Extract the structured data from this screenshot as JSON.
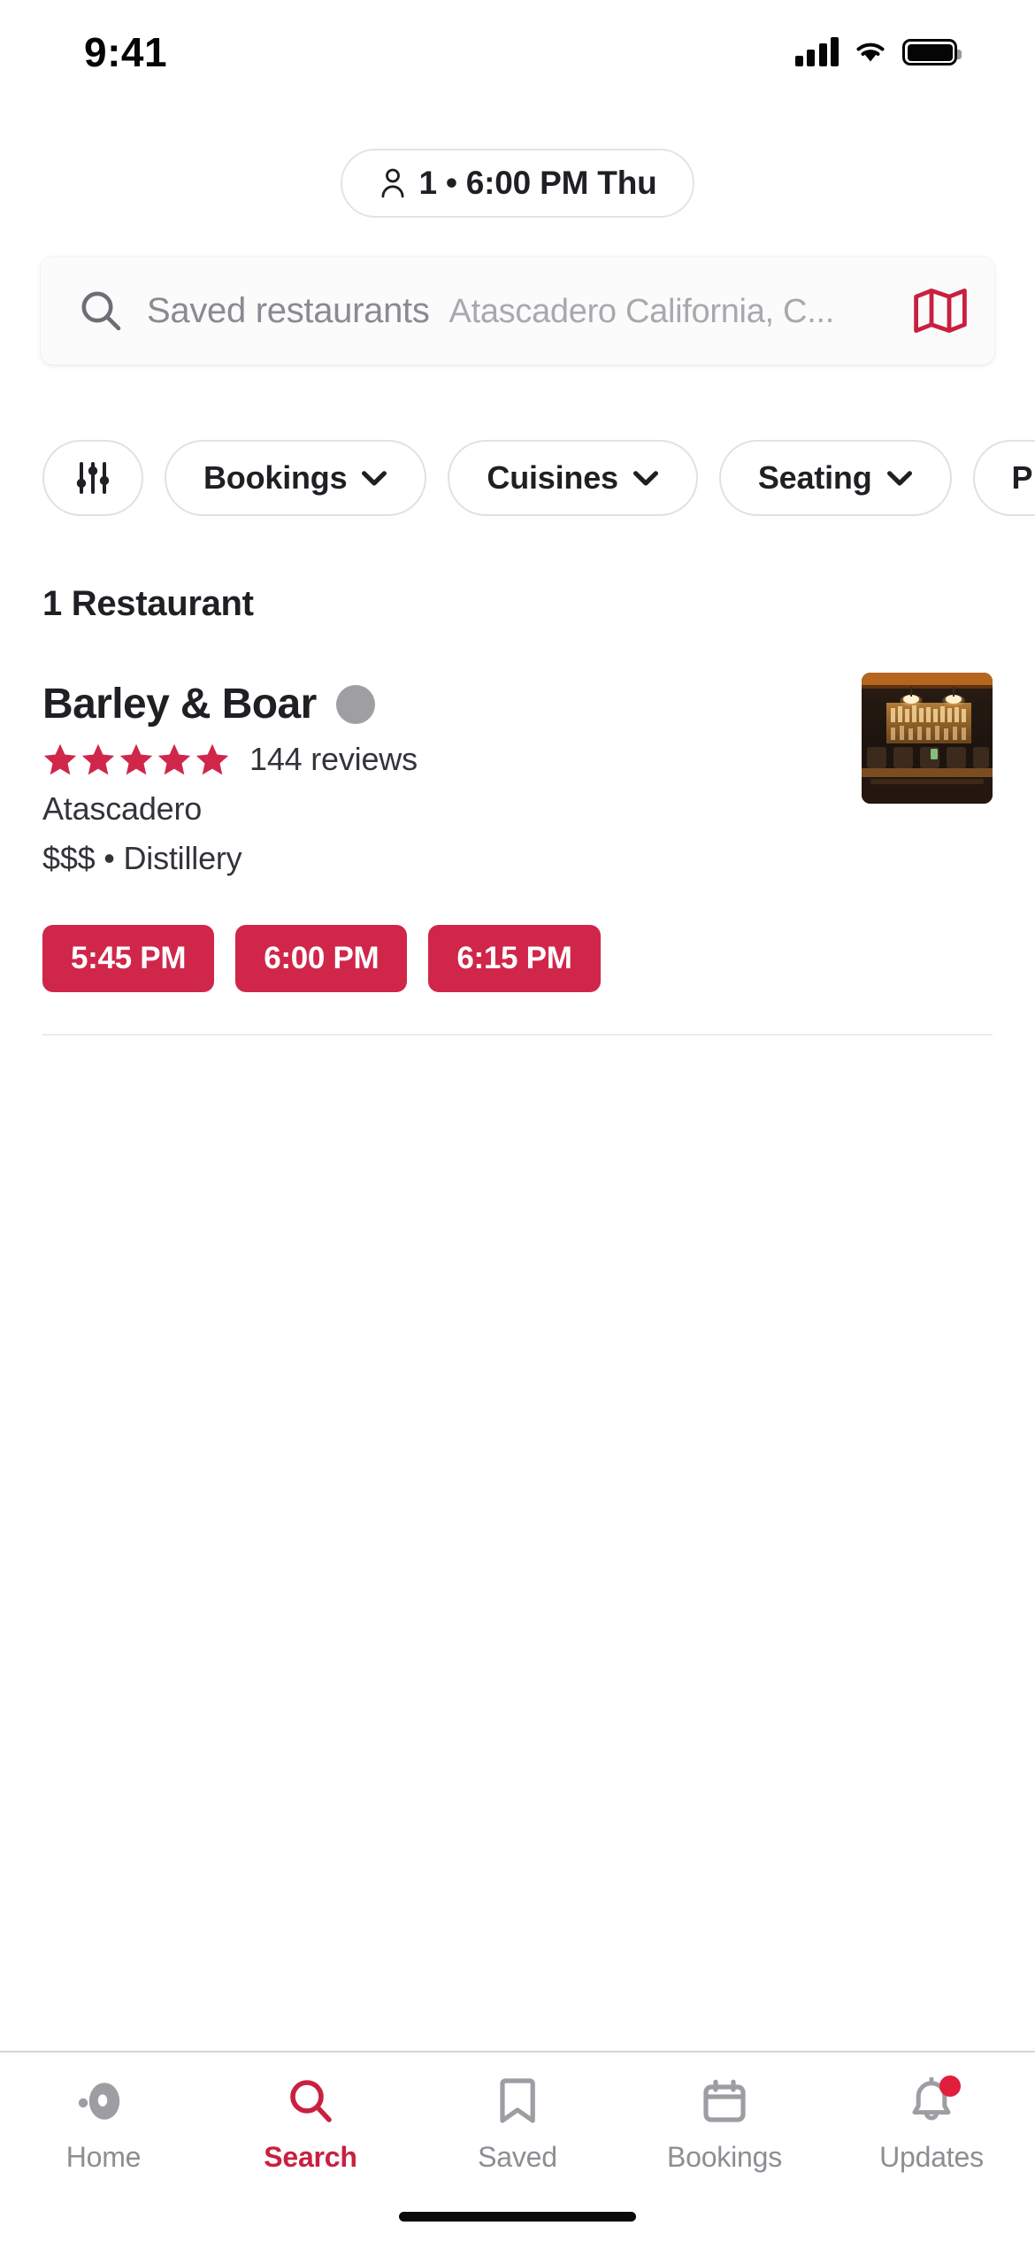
{
  "status_bar": {
    "time": "9:41",
    "signal_icon": "cellular-signal-icon",
    "wifi_icon": "wifi-icon",
    "battery_icon": "battery-icon"
  },
  "party_pill": {
    "icon": "person-icon",
    "text": "1 • 6:00 PM Thu"
  },
  "search": {
    "icon": "search-icon",
    "primary": "Saved restaurants",
    "secondary": "Atascadero California, C...",
    "map_icon": "map-icon",
    "map_icon_color": "#c9203f"
  },
  "filters": {
    "tune_icon": "filter-sliders-icon",
    "chips": [
      {
        "label": "Bookings",
        "has_chevron": true
      },
      {
        "label": "Cuisines",
        "has_chevron": true
      },
      {
        "label": "Seating",
        "has_chevron": true
      },
      {
        "label": "P",
        "has_chevron": false
      }
    ]
  },
  "results": {
    "count_label": "1 Restaurant"
  },
  "restaurant": {
    "name": "Barley & Boar",
    "status_dot": "availability-dot",
    "stars": 5,
    "star_color": "#d0264a",
    "reviews": "144 reviews",
    "location": "Atascadero",
    "meta": "$$$ • Distillery",
    "thumbnail_alt": "bar-interior-photo",
    "time_slots": [
      "5:45 PM",
      "6:00 PM",
      "6:15 PM"
    ]
  },
  "tabbar": {
    "accent_color": "#c9203f",
    "items": [
      {
        "label": "Home",
        "icon": "home-icon",
        "active": false,
        "badge": false
      },
      {
        "label": "Search",
        "icon": "search-icon",
        "active": true,
        "badge": false
      },
      {
        "label": "Saved",
        "icon": "bookmark-icon",
        "active": false,
        "badge": false
      },
      {
        "label": "Bookings",
        "icon": "calendar-icon",
        "active": false,
        "badge": false
      },
      {
        "label": "Updates",
        "icon": "bell-icon",
        "active": false,
        "badge": true
      }
    ]
  }
}
